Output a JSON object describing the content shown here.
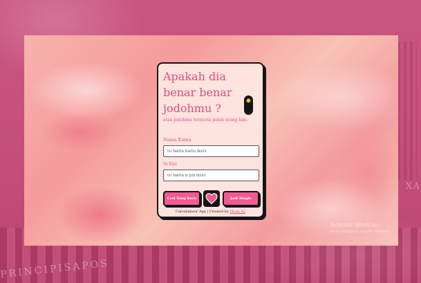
{
  "background": {
    "caption_left": "PRINCIPISAPOS",
    "caption_right": "XA"
  },
  "card": {
    "title": "Apakah dia benar benar jodohmu ?",
    "subtitle": "atau jodohmu ternyata jodoh orang lain.",
    "toggle_icon": "sun-icon",
    "fields": [
      {
        "label": "Nama Kamu",
        "value": "",
        "placeholder": "Isi Nama Kamu disini"
      },
      {
        "label": "Si Doi",
        "value": "",
        "placeholder": "Isi Nama si Doi disini"
      }
    ],
    "buttons": {
      "left": "Cari Yang Baru",
      "center_icon": "heart-icon",
      "right": "Jadi Single"
    },
    "footer": {
      "prefix": "Calculamour App | Created by",
      "author": "Ilham HJ"
    }
  },
  "watermark": {
    "line1": "Activate Windows",
    "line2": "Go to Settings to activate Windows."
  },
  "colors": {
    "accent": "#e24a86",
    "button": "#f25a92",
    "card_bg": "#fde4de",
    "outline": "#141414"
  }
}
